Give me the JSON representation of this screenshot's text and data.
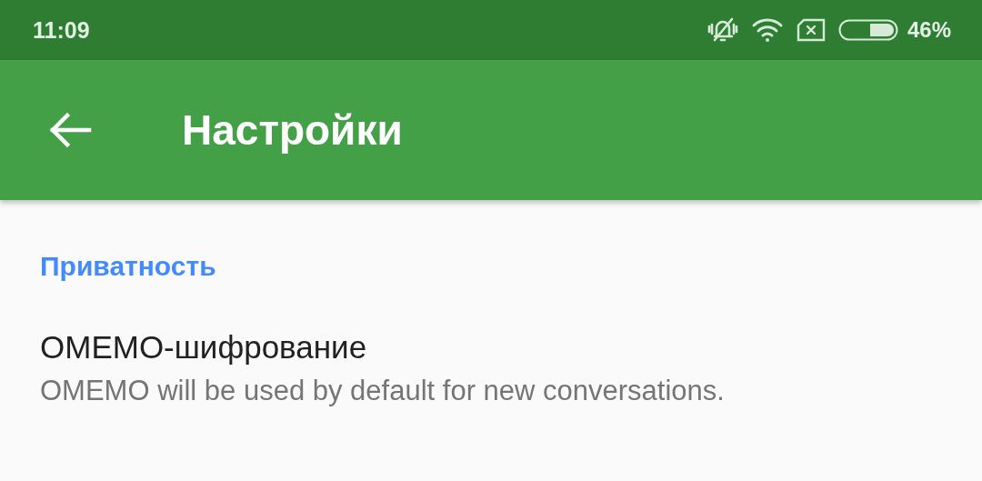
{
  "status_bar": {
    "time": "11:09",
    "battery": "46%"
  },
  "toolbar": {
    "title": "Настройки"
  },
  "sections": [
    {
      "header": "Приватность",
      "items": [
        {
          "title": "OMEMO-шифрование",
          "summary": "OMEMO will be used by default for new conversations."
        }
      ]
    }
  ]
}
